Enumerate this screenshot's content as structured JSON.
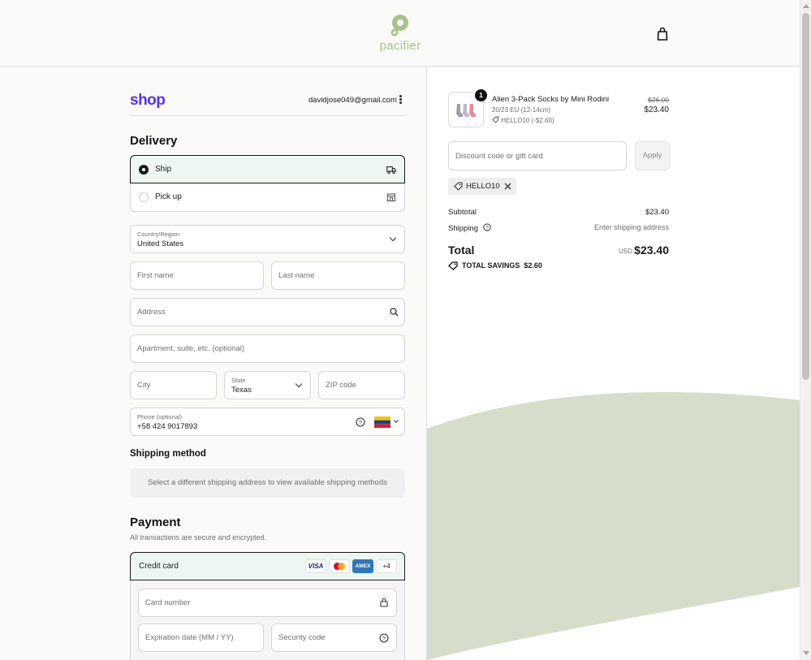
{
  "header": {
    "brand": "pacifier",
    "cart_icon": "shopping-bag-icon"
  },
  "account": {
    "shop_logo": "shop",
    "email": "davidjose049@gmail.com"
  },
  "delivery": {
    "title": "Delivery",
    "options": [
      {
        "label": "Ship",
        "selected": true,
        "icon": "truck-icon"
      },
      {
        "label": "Pick up",
        "selected": false,
        "icon": "store-icon"
      }
    ],
    "country": {
      "label": "Country/Region",
      "value": "United States"
    },
    "first_name": {
      "placeholder": "First name"
    },
    "last_name": {
      "placeholder": "Last name"
    },
    "address": {
      "placeholder": "Address"
    },
    "apartment": {
      "placeholder": "Apartment, suite, etc. (optional)"
    },
    "city": {
      "placeholder": "City"
    },
    "state": {
      "label": "State",
      "value": "Texas"
    },
    "zip": {
      "placeholder": "ZIP code"
    },
    "phone": {
      "label": "Phone (optional)",
      "value": "+58 424 9017893"
    }
  },
  "shipping_method": {
    "title": "Shipping method",
    "notice": "Select a different shipping address to view available shipping methods"
  },
  "payment": {
    "title": "Payment",
    "subtitle": "All transactions are secure and encrypted.",
    "method": "Credit card",
    "card_brands": [
      "VISA",
      "Mastercard",
      "AMEX",
      "+4"
    ],
    "card_number": {
      "placeholder": "Card number"
    },
    "expiration": {
      "placeholder": "Expiration date (MM / YY)"
    },
    "security_code": {
      "placeholder": "Security code"
    }
  },
  "order": {
    "item": {
      "quantity": "1",
      "name": "Alien 3-Pack Socks by Mini Rodini",
      "variant": "20/23 EU (12-14cm)",
      "discount": "HELLO10 (-$2.60)",
      "original_price": "$26.00",
      "price": "$23.40"
    },
    "discount_input": {
      "placeholder": "Discount code or gift card"
    },
    "apply_label": "Apply",
    "applied_code": "HELLO10",
    "subtotal_label": "Subtotal",
    "subtotal_value": "$23.40",
    "shipping_label": "Shipping",
    "shipping_value": "Enter shipping address",
    "total_label": "Total",
    "currency": "USD",
    "total_value": "$23.40",
    "savings_label": "TOTAL SAVINGS",
    "savings_value": "$2.60"
  },
  "colors": {
    "shop_purple": "#5a31f4",
    "brand_green": "#aac28a",
    "wave_green": "#d6ddcb",
    "selected_bg": "#eef6f2"
  }
}
